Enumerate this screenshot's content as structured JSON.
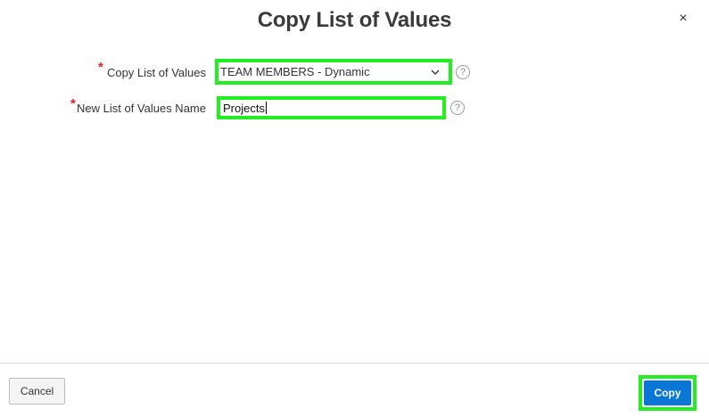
{
  "dialog": {
    "title": "Copy List of Values",
    "close_symbol": "×"
  },
  "form": {
    "copy_lov": {
      "label": "Copy List of Values",
      "required_marker": "*",
      "selected_value": "TEAM MEMBERS - Dynamic",
      "help_symbol": "?"
    },
    "new_lov_name": {
      "label": "New List of Values Name",
      "required_marker": "*",
      "value": "Projects",
      "help_symbol": "?"
    }
  },
  "footer": {
    "cancel_label": "Cancel",
    "copy_label": "Copy"
  },
  "colors": {
    "highlight": "#22ee22",
    "primary_button": "#0a76d6",
    "required": "#e0201b"
  },
  "icons": {
    "close": "close-icon",
    "dropdown": "chevron-down-icon",
    "help": "help-icon"
  }
}
